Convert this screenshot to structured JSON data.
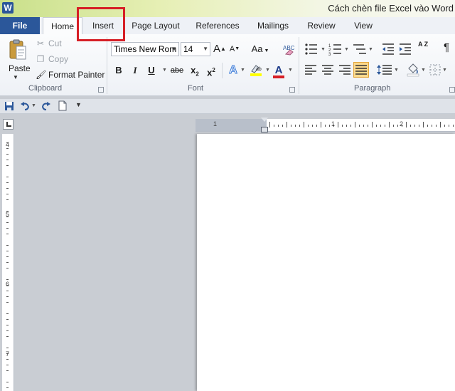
{
  "app": {
    "icon_letter": "W",
    "window_title": "Cách chèn file Excel vào Word"
  },
  "tabs": [
    {
      "id": "file",
      "label": "File"
    },
    {
      "id": "home",
      "label": "Home"
    },
    {
      "id": "insert",
      "label": "Insert"
    },
    {
      "id": "page-layout",
      "label": "Page Layout"
    },
    {
      "id": "references",
      "label": "References"
    },
    {
      "id": "mailings",
      "label": "Mailings"
    },
    {
      "id": "review",
      "label": "Review"
    },
    {
      "id": "view",
      "label": "View"
    }
  ],
  "active_tab": "home",
  "highlighted_tab": "insert",
  "colors": {
    "file_tab": "#2b579a",
    "highlight_box": "#d61f26",
    "text_highlight": "#ffff00",
    "font_color": "#d61f26",
    "justify_active": "#fbd98c"
  },
  "clipboard": {
    "paste_label": "Paste",
    "cut_label": "Cut",
    "copy_label": "Copy",
    "format_painter_label": "Format Painter",
    "group_label": "Clipboard"
  },
  "font": {
    "family": "Times New Rom",
    "size": "14",
    "group_label": "Font",
    "grow_glyph": "A",
    "shrink_glyph": "A",
    "case_glyph": "Aa",
    "bold": "B",
    "italic": "I",
    "underline": "U",
    "strikethrough": "abe",
    "subscript": "x",
    "subscript_mark": "2",
    "superscript": "x",
    "superscript_mark": "2",
    "effects_glyph": "A",
    "font_color_glyph": "A"
  },
  "paragraph": {
    "group_label": "Paragraph",
    "sort_glyph": "A Z",
    "pilcrow": "¶"
  },
  "ruler": {
    "horizontal_numbers": [
      "1",
      "1",
      "2"
    ],
    "vertical_numbers": [
      "4",
      "5",
      "6",
      "7"
    ]
  }
}
